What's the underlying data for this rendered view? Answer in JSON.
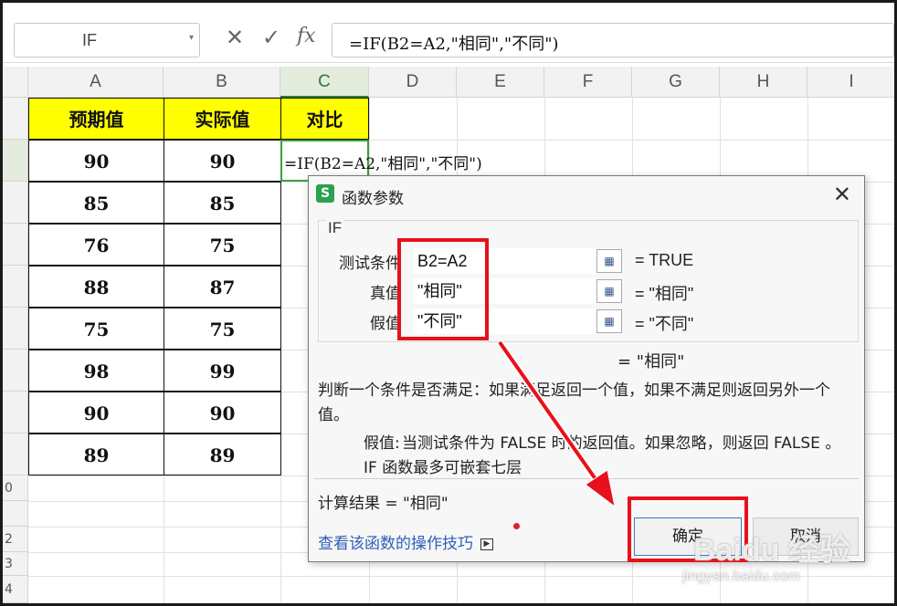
{
  "formula_bar": {
    "name_box": "IF",
    "cancel_icon": "close-icon",
    "confirm_icon": "check-icon",
    "fx_label": "fx",
    "formula": "=IF(B2=A2,\"相同\",\"不同\")"
  },
  "columns": [
    "A",
    "B",
    "C",
    "D",
    "E",
    "F",
    "G",
    "H",
    "I"
  ],
  "active_column": "C",
  "row_numbers": [
    "",
    "",
    "",
    "",
    "",
    "",
    "",
    "",
    "",
    "0",
    "",
    "2",
    "3",
    "4"
  ],
  "table": {
    "headers": [
      "预期值",
      "实际值",
      "对比"
    ],
    "rows": [
      [
        "90",
        "90"
      ],
      [
        "85",
        "85"
      ],
      [
        "76",
        "75"
      ],
      [
        "88",
        "87"
      ],
      [
        "75",
        "75"
      ],
      [
        "98",
        "99"
      ],
      [
        "90",
        "90"
      ],
      [
        "89",
        "89"
      ]
    ],
    "editing_cell_text": "=IF(B2=A2,\"相同\",\"不同\")"
  },
  "dialog": {
    "title": "函数参数",
    "group_label": "IF",
    "args": [
      {
        "label": "测试条件",
        "value": "B2=A2",
        "result": "= TRUE"
      },
      {
        "label": "真值",
        "value": "\"相同\"",
        "result": "= \"相同\""
      },
      {
        "label": "假值",
        "value": "\"不同\"",
        "result": "= \"不同\""
      }
    ],
    "result_line": "= \"相同\"",
    "description": "判断一个条件是否满足：如果满足返回一个值，如果不满足则返回另外一个值。",
    "param_desc_label": "假值:",
    "param_desc": "当测试条件为 FALSE 时的返回值。如果忽略，则返回 FALSE 。 IF 函数最多可嵌套七层",
    "calc_result": "计算结果 = \"相同\"",
    "help_link": "查看该函数的操作技巧",
    "ok_label": "确定",
    "cancel_label": "取消"
  },
  "watermark": {
    "brand": "Baidu 经验",
    "url": "jingyan.baidu.com"
  },
  "colors": {
    "header_fill": "#ffff00",
    "highlight": "#e8101a",
    "selection": "#3b9e45"
  }
}
